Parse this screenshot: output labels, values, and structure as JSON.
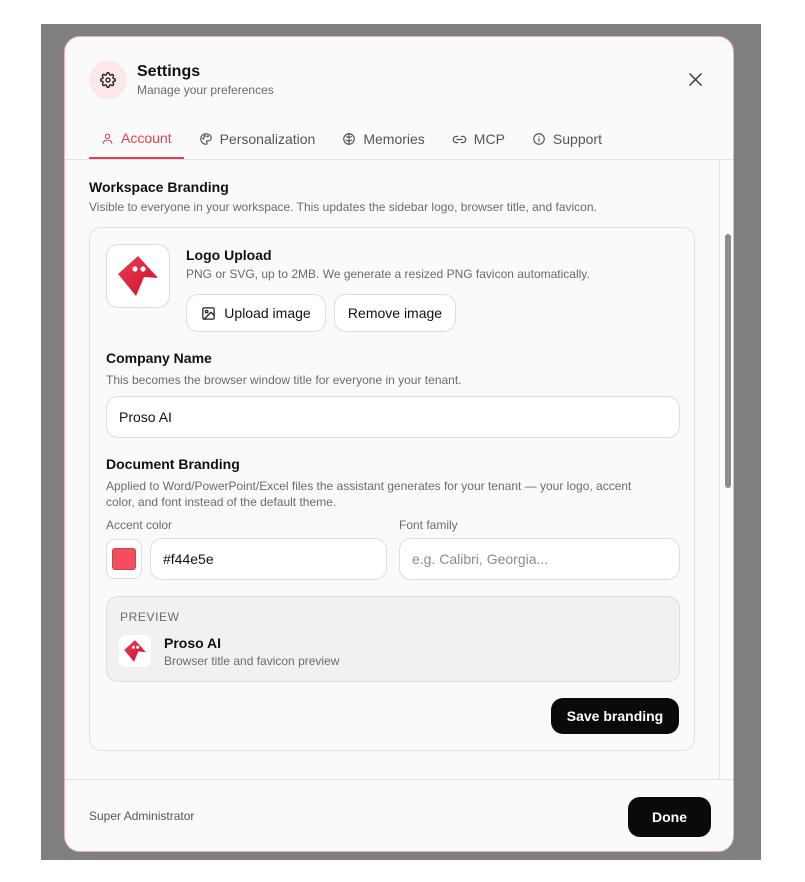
{
  "header": {
    "title": "Settings",
    "subtitle": "Manage your preferences"
  },
  "tabs": [
    {
      "label": "Account",
      "icon": "user-icon",
      "active": true
    },
    {
      "label": "Personalization",
      "icon": "palette-icon",
      "active": false
    },
    {
      "label": "Memories",
      "icon": "brain-icon",
      "active": false
    },
    {
      "label": "MCP",
      "icon": "link-icon",
      "active": false
    },
    {
      "label": "Support",
      "icon": "info-icon",
      "active": false
    }
  ],
  "branding": {
    "title": "Workspace Branding",
    "description": "Visible to everyone in your workspace. This updates the sidebar logo, browser title, and favicon.",
    "logo": {
      "title": "Logo Upload",
      "description": "PNG or SVG, up to 2MB. We generate a resized PNG favicon automatically.",
      "upload_label": "Upload image",
      "remove_label": "Remove image"
    },
    "company": {
      "title": "Company Name",
      "description": "This becomes the browser window title for everyone in your tenant.",
      "value": "Proso AI"
    },
    "document": {
      "title": "Document Branding",
      "description_line1": "Applied to Word/PowerPoint/Excel files the assistant generates for your tenant — your logo, accent",
      "description_line2": "color, and font instead of the default theme.",
      "accent_label": "Accent color",
      "accent_value": "#f44e5e",
      "font_label": "Font family",
      "font_placeholder": "e.g. Calibri, Georgia..."
    },
    "preview": {
      "label": "PREVIEW",
      "name": "Proso AI",
      "subtitle": "Browser title and favicon preview"
    },
    "save_label": "Save branding"
  },
  "footer": {
    "role": "Super Administrator",
    "done_label": "Done"
  },
  "colors": {
    "accent": "#f44e5e",
    "active_tab": "#e0414e",
    "logo_red": "#e8334a"
  }
}
